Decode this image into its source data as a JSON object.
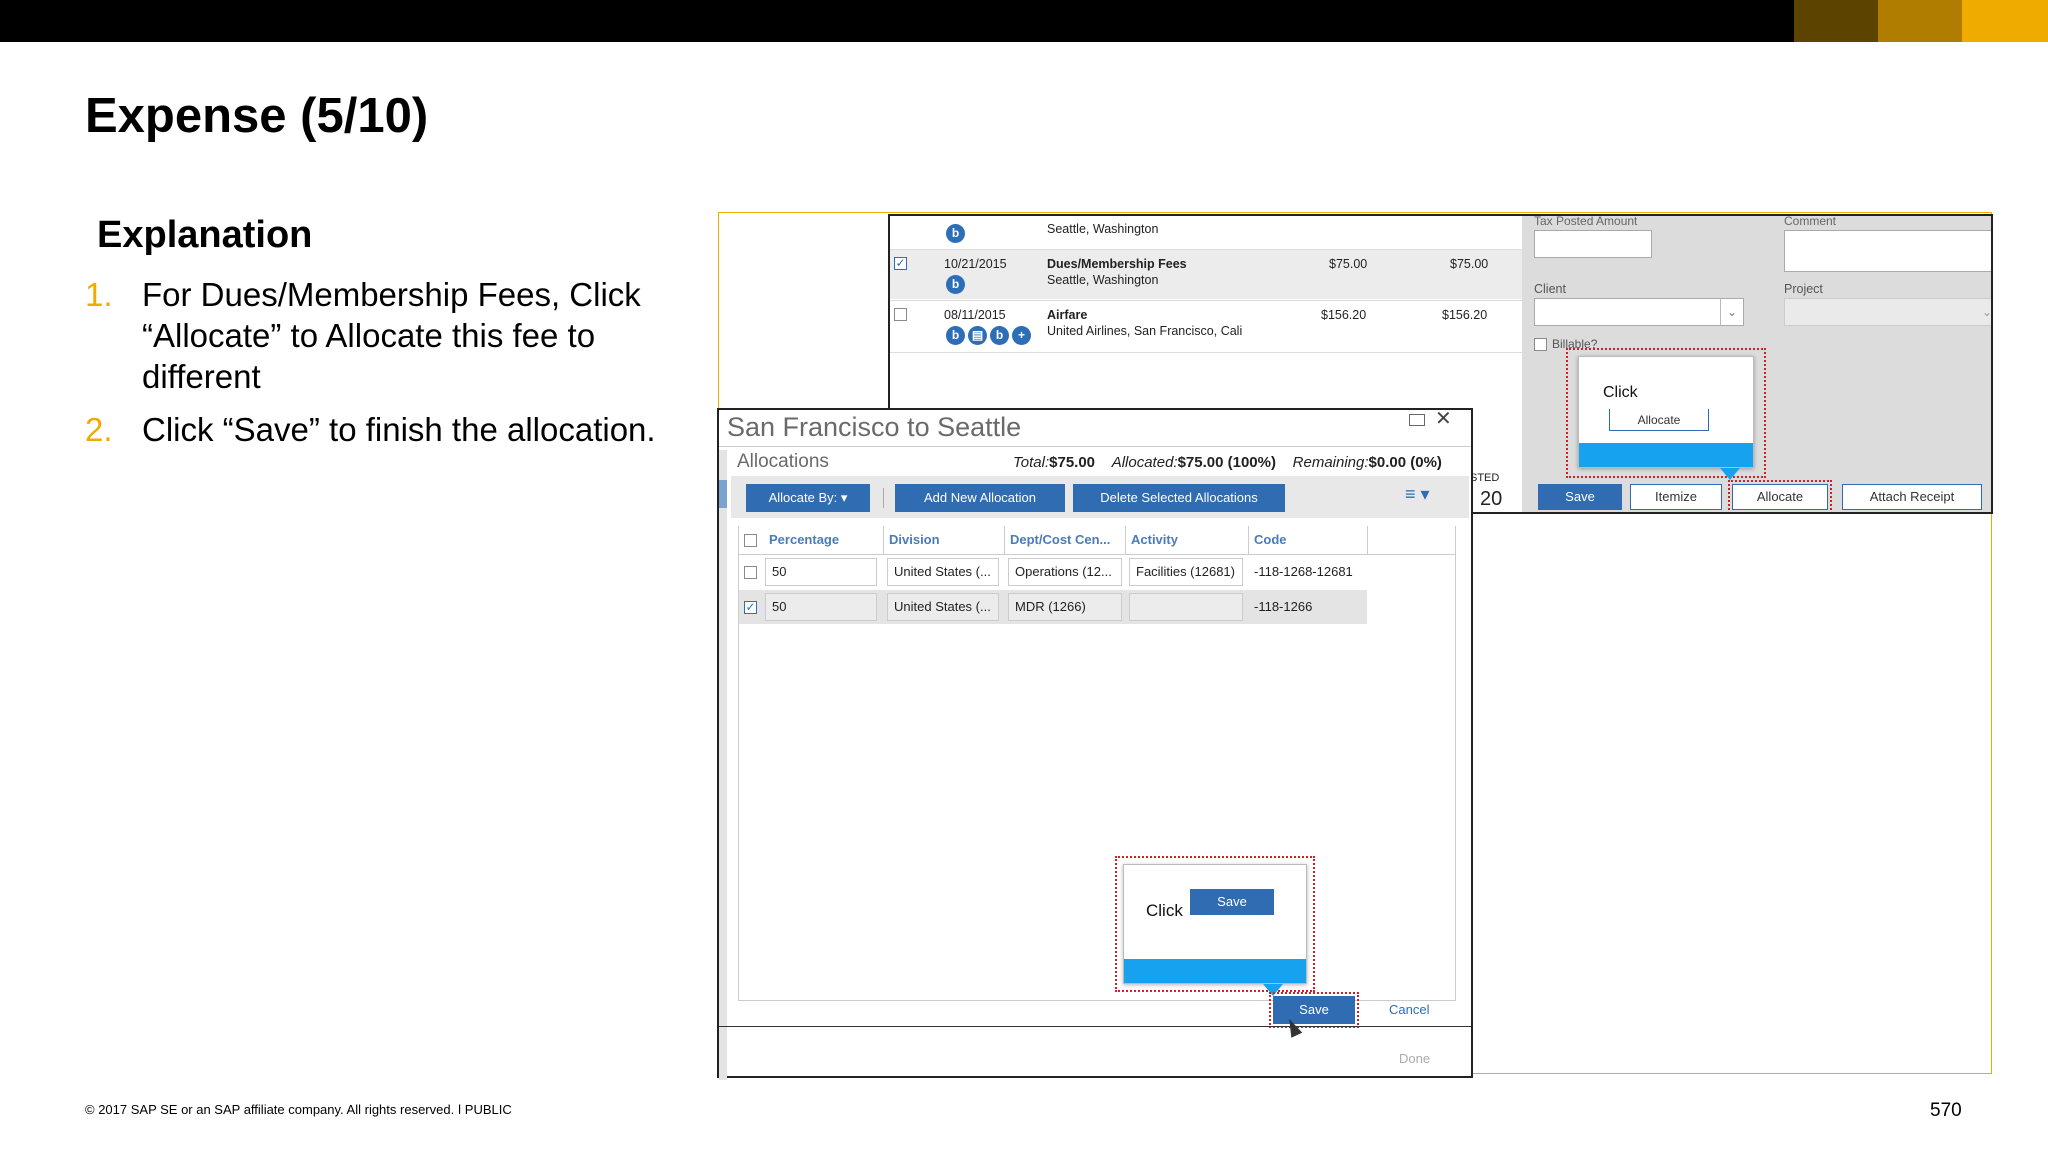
{
  "slide": {
    "title": "Expense (5/10)",
    "explanation_heading": "Explanation",
    "steps": [
      {
        "num": "1.",
        "text": "For Dues/Membership Fees, Click “Allocate” to Allocate this fee to different"
      },
      {
        "num": "2.",
        "text": "Click “Save” to finish the allocation."
      }
    ],
    "footer": "© 2017 SAP SE or an SAP affiliate company. All rights reserved.   ǀ   PUBLIC",
    "page_number": "570",
    "colors": {
      "accent": "#f0ab00",
      "swatch1": "#5c4300",
      "swatch2": "#b07d00",
      "swatch3": "#f0ab00",
      "sap_blue": "#2f6cb2",
      "callout_blue": "#16a2ee",
      "highlight_red": "#d21f28"
    }
  },
  "expense_list": {
    "row0": {
      "location": "Seattle, Washington"
    },
    "row1": {
      "date": "10/21/2015",
      "name": "Dues/Membership Fees",
      "location": "Seattle, Washington",
      "amount": "$75.00",
      "requested": "$75.00",
      "checked": true
    },
    "row2": {
      "date": "08/11/2015",
      "name": "Airfare",
      "location": "United Airlines, San Francisco, Cali",
      "amount": "$156.20",
      "requested": "$156.20",
      "checked": false
    },
    "icon_glyph": "b"
  },
  "expense_form": {
    "tax_posted_label": "Tax Posted Amount",
    "comment_label": "Comment",
    "client_label": "Client",
    "project_label": "Project",
    "billable_label": "Billable?",
    "partial_label": "STED",
    "partial_value": "20",
    "buttons": {
      "save": "Save",
      "itemize": "Itemize",
      "allocate": "Allocate",
      "attach": "Attach Receipt"
    },
    "callout": {
      "click": "Click",
      "button": "Allocate"
    }
  },
  "dialog": {
    "title": "San Francisco to Seattle",
    "section": "Allocations",
    "total_label": "Total:",
    "total_value": "$75.00",
    "allocated_label": "Allocated:",
    "allocated_value": "$75.00 (100%)",
    "remaining_label": "Remaining:",
    "remaining_value": "$0.00 (0%)",
    "toolbar": {
      "allocate_by": "Allocate By: ▾",
      "add_new": "Add New Allocation",
      "delete_selected": "Delete Selected Allocations",
      "menu_icon": "≡ ▾"
    },
    "columns": [
      "Percentage",
      "Division",
      "Dept/Cost Cen...",
      "Activity",
      "Code"
    ],
    "rows": [
      {
        "checked": false,
        "percentage": "50",
        "division": "United States (...",
        "dept": "Operations (12...",
        "activity": "Facilities (12681)",
        "code": "-118-1268-12681"
      },
      {
        "checked": true,
        "percentage": "50",
        "division": "United States (...",
        "dept": "MDR (1266)",
        "activity": "",
        "code": "-118-1266"
      }
    ],
    "callout": {
      "click": "Click",
      "button": "Save"
    },
    "save": "Save",
    "cancel": "Cancel",
    "done": "Done"
  }
}
